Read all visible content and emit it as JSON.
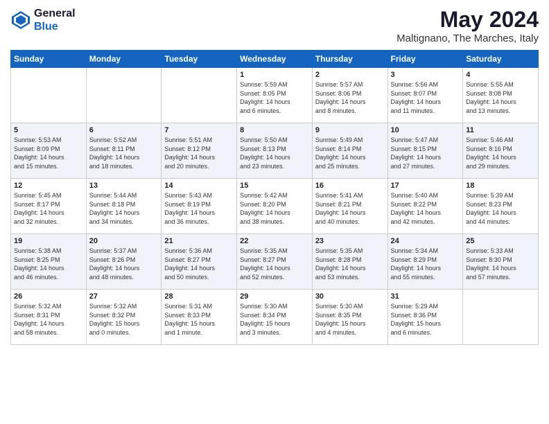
{
  "header": {
    "logo_general": "General",
    "logo_blue": "Blue",
    "title": "May 2024",
    "subtitle": "Maltignano, The Marches, Italy"
  },
  "columns": [
    "Sunday",
    "Monday",
    "Tuesday",
    "Wednesday",
    "Thursday",
    "Friday",
    "Saturday"
  ],
  "weeks": [
    [
      {
        "day": "",
        "info": ""
      },
      {
        "day": "",
        "info": ""
      },
      {
        "day": "",
        "info": ""
      },
      {
        "day": "1",
        "info": "Sunrise: 5:59 AM\nSunset: 8:05 PM\nDaylight: 14 hours\nand 6 minutes."
      },
      {
        "day": "2",
        "info": "Sunrise: 5:57 AM\nSunset: 8:06 PM\nDaylight: 14 hours\nand 8 minutes."
      },
      {
        "day": "3",
        "info": "Sunrise: 5:56 AM\nSunset: 8:07 PM\nDaylight: 14 hours\nand 11 minutes."
      },
      {
        "day": "4",
        "info": "Sunrise: 5:55 AM\nSunset: 8:08 PM\nDaylight: 14 hours\nand 13 minutes."
      }
    ],
    [
      {
        "day": "5",
        "info": "Sunrise: 5:53 AM\nSunset: 8:09 PM\nDaylight: 14 hours\nand 15 minutes."
      },
      {
        "day": "6",
        "info": "Sunrise: 5:52 AM\nSunset: 8:11 PM\nDaylight: 14 hours\nand 18 minutes."
      },
      {
        "day": "7",
        "info": "Sunrise: 5:51 AM\nSunset: 8:12 PM\nDaylight: 14 hours\nand 20 minutes."
      },
      {
        "day": "8",
        "info": "Sunrise: 5:50 AM\nSunset: 8:13 PM\nDaylight: 14 hours\nand 23 minutes."
      },
      {
        "day": "9",
        "info": "Sunrise: 5:49 AM\nSunset: 8:14 PM\nDaylight: 14 hours\nand 25 minutes."
      },
      {
        "day": "10",
        "info": "Sunrise: 5:47 AM\nSunset: 8:15 PM\nDaylight: 14 hours\nand 27 minutes."
      },
      {
        "day": "11",
        "info": "Sunrise: 5:46 AM\nSunset: 8:16 PM\nDaylight: 14 hours\nand 29 minutes."
      }
    ],
    [
      {
        "day": "12",
        "info": "Sunrise: 5:45 AM\nSunset: 8:17 PM\nDaylight: 14 hours\nand 32 minutes."
      },
      {
        "day": "13",
        "info": "Sunrise: 5:44 AM\nSunset: 8:18 PM\nDaylight: 14 hours\nand 34 minutes."
      },
      {
        "day": "14",
        "info": "Sunrise: 5:43 AM\nSunset: 8:19 PM\nDaylight: 14 hours\nand 36 minutes."
      },
      {
        "day": "15",
        "info": "Sunrise: 5:42 AM\nSunset: 8:20 PM\nDaylight: 14 hours\nand 38 minutes."
      },
      {
        "day": "16",
        "info": "Sunrise: 5:41 AM\nSunset: 8:21 PM\nDaylight: 14 hours\nand 40 minutes."
      },
      {
        "day": "17",
        "info": "Sunrise: 5:40 AM\nSunset: 8:22 PM\nDaylight: 14 hours\nand 42 minutes."
      },
      {
        "day": "18",
        "info": "Sunrise: 5:39 AM\nSunset: 8:23 PM\nDaylight: 14 hours\nand 44 minutes."
      }
    ],
    [
      {
        "day": "19",
        "info": "Sunrise: 5:38 AM\nSunset: 8:25 PM\nDaylight: 14 hours\nand 46 minutes."
      },
      {
        "day": "20",
        "info": "Sunrise: 5:37 AM\nSunset: 8:26 PM\nDaylight: 14 hours\nand 48 minutes."
      },
      {
        "day": "21",
        "info": "Sunrise: 5:36 AM\nSunset: 8:27 PM\nDaylight: 14 hours\nand 50 minutes."
      },
      {
        "day": "22",
        "info": "Sunrise: 5:35 AM\nSunset: 8:27 PM\nDaylight: 14 hours\nand 52 minutes."
      },
      {
        "day": "23",
        "info": "Sunrise: 5:35 AM\nSunset: 8:28 PM\nDaylight: 14 hours\nand 53 minutes."
      },
      {
        "day": "24",
        "info": "Sunrise: 5:34 AM\nSunset: 8:29 PM\nDaylight: 14 hours\nand 55 minutes."
      },
      {
        "day": "25",
        "info": "Sunrise: 5:33 AM\nSunset: 8:30 PM\nDaylight: 14 hours\nand 57 minutes."
      }
    ],
    [
      {
        "day": "26",
        "info": "Sunrise: 5:32 AM\nSunset: 8:31 PM\nDaylight: 14 hours\nand 58 minutes."
      },
      {
        "day": "27",
        "info": "Sunrise: 5:32 AM\nSunset: 8:32 PM\nDaylight: 15 hours\nand 0 minutes."
      },
      {
        "day": "28",
        "info": "Sunrise: 5:31 AM\nSunset: 8:33 PM\nDaylight: 15 hours\nand 1 minute."
      },
      {
        "day": "29",
        "info": "Sunrise: 5:30 AM\nSunset: 8:34 PM\nDaylight: 15 hours\nand 3 minutes."
      },
      {
        "day": "30",
        "info": "Sunrise: 5:30 AM\nSunset: 8:35 PM\nDaylight: 15 hours\nand 4 minutes."
      },
      {
        "day": "31",
        "info": "Sunrise: 5:29 AM\nSunset: 8:36 PM\nDaylight: 15 hours\nand 6 minutes."
      },
      {
        "day": "",
        "info": ""
      }
    ]
  ]
}
